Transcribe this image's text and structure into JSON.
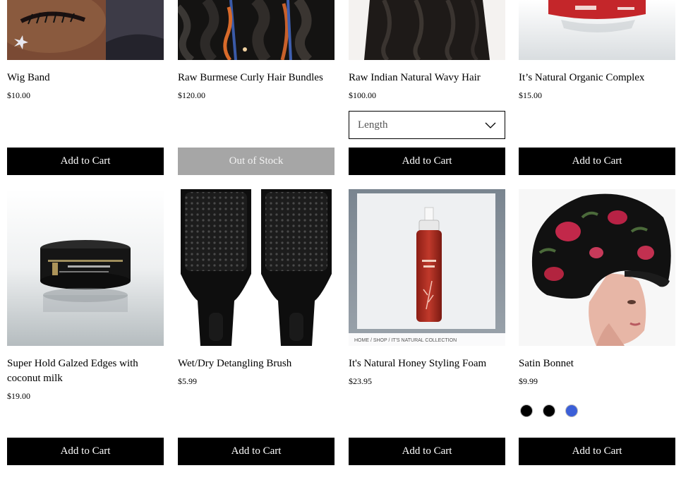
{
  "row1": [
    {
      "title": "Wig Band",
      "price": "$10.00",
      "button": "Add to Cart",
      "image": "wig-band-photo"
    },
    {
      "title": "Raw Burmese Curly Hair Bundles",
      "price": "$120.00",
      "button": "Out of Stock",
      "image": "curly-hair-bundles-photo"
    },
    {
      "title": "Raw Indian Natural Wavy Hair",
      "price": "$100.00",
      "button": "Add to Cart",
      "image": "wavy-hair-photo",
      "select_placeholder": "Length"
    },
    {
      "title": "It’s Natural Organic Complex",
      "price": "$15.00",
      "button": "Add to Cart",
      "image": "organic-complex-jar-photo"
    }
  ],
  "row2": [
    {
      "title": "Super Hold Galzed Edges with coconut milk",
      "price": "$19.00",
      "button": "Add to Cart",
      "image": "edges-jar-photo"
    },
    {
      "title": "Wet/Dry Detangling Brush",
      "price": "$5.99",
      "button": "Add to Cart",
      "image": "detangling-brush-photo"
    },
    {
      "title": "It's Natural Honey Styling Foam",
      "price": "$23.95",
      "button": "Add to Cart",
      "image": "styling-foam-photo",
      "image_caption": "HOME / SHOP / IT'S NATURAL COLLECTION"
    },
    {
      "title": "Satin Bonnet",
      "price": "$9.99",
      "button": "Add to Cart",
      "image": "satin-bonnet-photo"
    }
  ],
  "swatch_colors": [
    "#000000",
    "#000000",
    "#3b5fd8"
  ],
  "colors": {
    "button": "#000000",
    "button_disabled": "#a6a6a6"
  }
}
